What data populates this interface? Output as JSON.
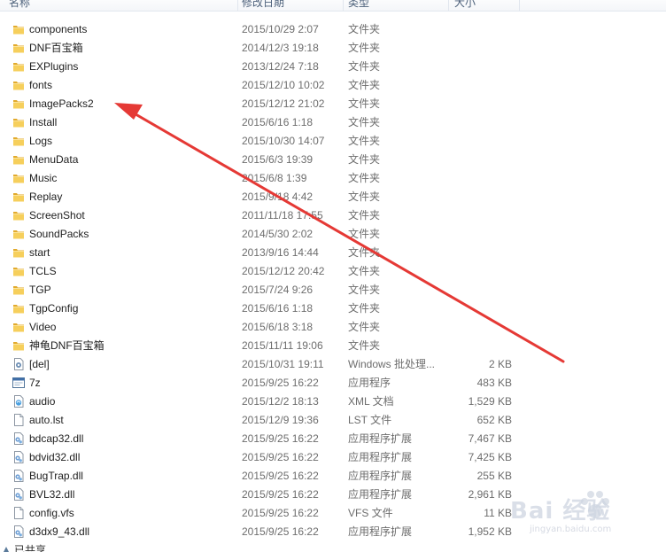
{
  "header": {
    "name": "名称",
    "date": "修改日期",
    "type": "类型",
    "size": "大小"
  },
  "files": [
    {
      "name": "components",
      "date": "2015/10/29 2:07",
      "type": "文件夹",
      "size": "",
      "icon": "folder-icon"
    },
    {
      "name": "DNF百宝箱",
      "date": "2014/12/3 19:18",
      "type": "文件夹",
      "size": "",
      "icon": "folder-icon"
    },
    {
      "name": "EXPlugins",
      "date": "2013/12/24 7:18",
      "type": "文件夹",
      "size": "",
      "icon": "folder-icon"
    },
    {
      "name": "fonts",
      "date": "2015/12/10 10:02",
      "type": "文件夹",
      "size": "",
      "icon": "folder-icon"
    },
    {
      "name": "ImagePacks2",
      "date": "2015/12/12 21:02",
      "type": "文件夹",
      "size": "",
      "icon": "folder-icon"
    },
    {
      "name": "Install",
      "date": "2015/6/16 1:18",
      "type": "文件夹",
      "size": "",
      "icon": "folder-icon"
    },
    {
      "name": "Logs",
      "date": "2015/10/30 14:07",
      "type": "文件夹",
      "size": "",
      "icon": "folder-icon"
    },
    {
      "name": "MenuData",
      "date": "2015/6/3 19:39",
      "type": "文件夹",
      "size": "",
      "icon": "folder-icon"
    },
    {
      "name": "Music",
      "date": "2015/6/8 1:39",
      "type": "文件夹",
      "size": "",
      "icon": "folder-icon"
    },
    {
      "name": "Replay",
      "date": "2015/9/18 4:42",
      "type": "文件夹",
      "size": "",
      "icon": "folder-icon"
    },
    {
      "name": "ScreenShot",
      "date": "2011/11/18 17:55",
      "type": "文件夹",
      "size": "",
      "icon": "folder-icon"
    },
    {
      "name": "SoundPacks",
      "date": "2014/5/30 2:02",
      "type": "文件夹",
      "size": "",
      "icon": "folder-icon"
    },
    {
      "name": "start",
      "date": "2013/9/16 14:44",
      "type": "文件夹",
      "size": "",
      "icon": "folder-icon"
    },
    {
      "name": "TCLS",
      "date": "2015/12/12 20:42",
      "type": "文件夹",
      "size": "",
      "icon": "folder-icon"
    },
    {
      "name": "TGP",
      "date": "2015/7/24 9:26",
      "type": "文件夹",
      "size": "",
      "icon": "folder-icon"
    },
    {
      "name": "TgpConfig",
      "date": "2015/6/16 1:18",
      "type": "文件夹",
      "size": "",
      "icon": "folder-icon"
    },
    {
      "name": "Video",
      "date": "2015/6/18 3:18",
      "type": "文件夹",
      "size": "",
      "icon": "folder-icon"
    },
    {
      "name": "神龟DNF百宝箱",
      "date": "2015/11/11 19:06",
      "type": "文件夹",
      "size": "",
      "icon": "folder-icon"
    },
    {
      "name": "[del]",
      "date": "2015/10/31 19:11",
      "type": "Windows 批处理...",
      "size": "2 KB",
      "icon": "batch-file-icon"
    },
    {
      "name": "7z",
      "date": "2015/9/25 16:22",
      "type": "应用程序",
      "size": "483 KB",
      "icon": "application-icon"
    },
    {
      "name": "audio",
      "date": "2015/12/2 18:13",
      "type": "XML 文档",
      "size": "1,529 KB",
      "icon": "xml-file-icon"
    },
    {
      "name": "auto.lst",
      "date": "2015/12/9 19:36",
      "type": "LST 文件",
      "size": "652 KB",
      "icon": "blank-file-icon"
    },
    {
      "name": "bdcap32.dll",
      "date": "2015/9/25 16:22",
      "type": "应用程序扩展",
      "size": "7,467 KB",
      "icon": "dll-file-icon"
    },
    {
      "name": "bdvid32.dll",
      "date": "2015/9/25 16:22",
      "type": "应用程序扩展",
      "size": "7,425 KB",
      "icon": "dll-file-icon"
    },
    {
      "name": "BugTrap.dll",
      "date": "2015/9/25 16:22",
      "type": "应用程序扩展",
      "size": "255 KB",
      "icon": "dll-file-icon"
    },
    {
      "name": "BVL32.dll",
      "date": "2015/9/25 16:22",
      "type": "应用程序扩展",
      "size": "2,961 KB",
      "icon": "dll-file-icon"
    },
    {
      "name": "config.vfs",
      "date": "2015/9/25 16:22",
      "type": "VFS 文件",
      "size": "11 KB",
      "icon": "blank-file-icon"
    },
    {
      "name": "d3dx9_43.dll",
      "date": "2015/9/25 16:22",
      "type": "应用程序扩展",
      "size": "1,952 KB",
      "icon": "dll-file-icon"
    }
  ],
  "status": {
    "text": "已共享",
    "icon": "share-icon"
  },
  "watermark": {
    "text": "Bai 经验",
    "sub": "jingyan.baidu.com"
  },
  "colors": {
    "folder": "#e8b83a",
    "annotation_arrow": "#e53935",
    "header_text": "#4c607a",
    "secondary_text": "#6d6d6d"
  }
}
